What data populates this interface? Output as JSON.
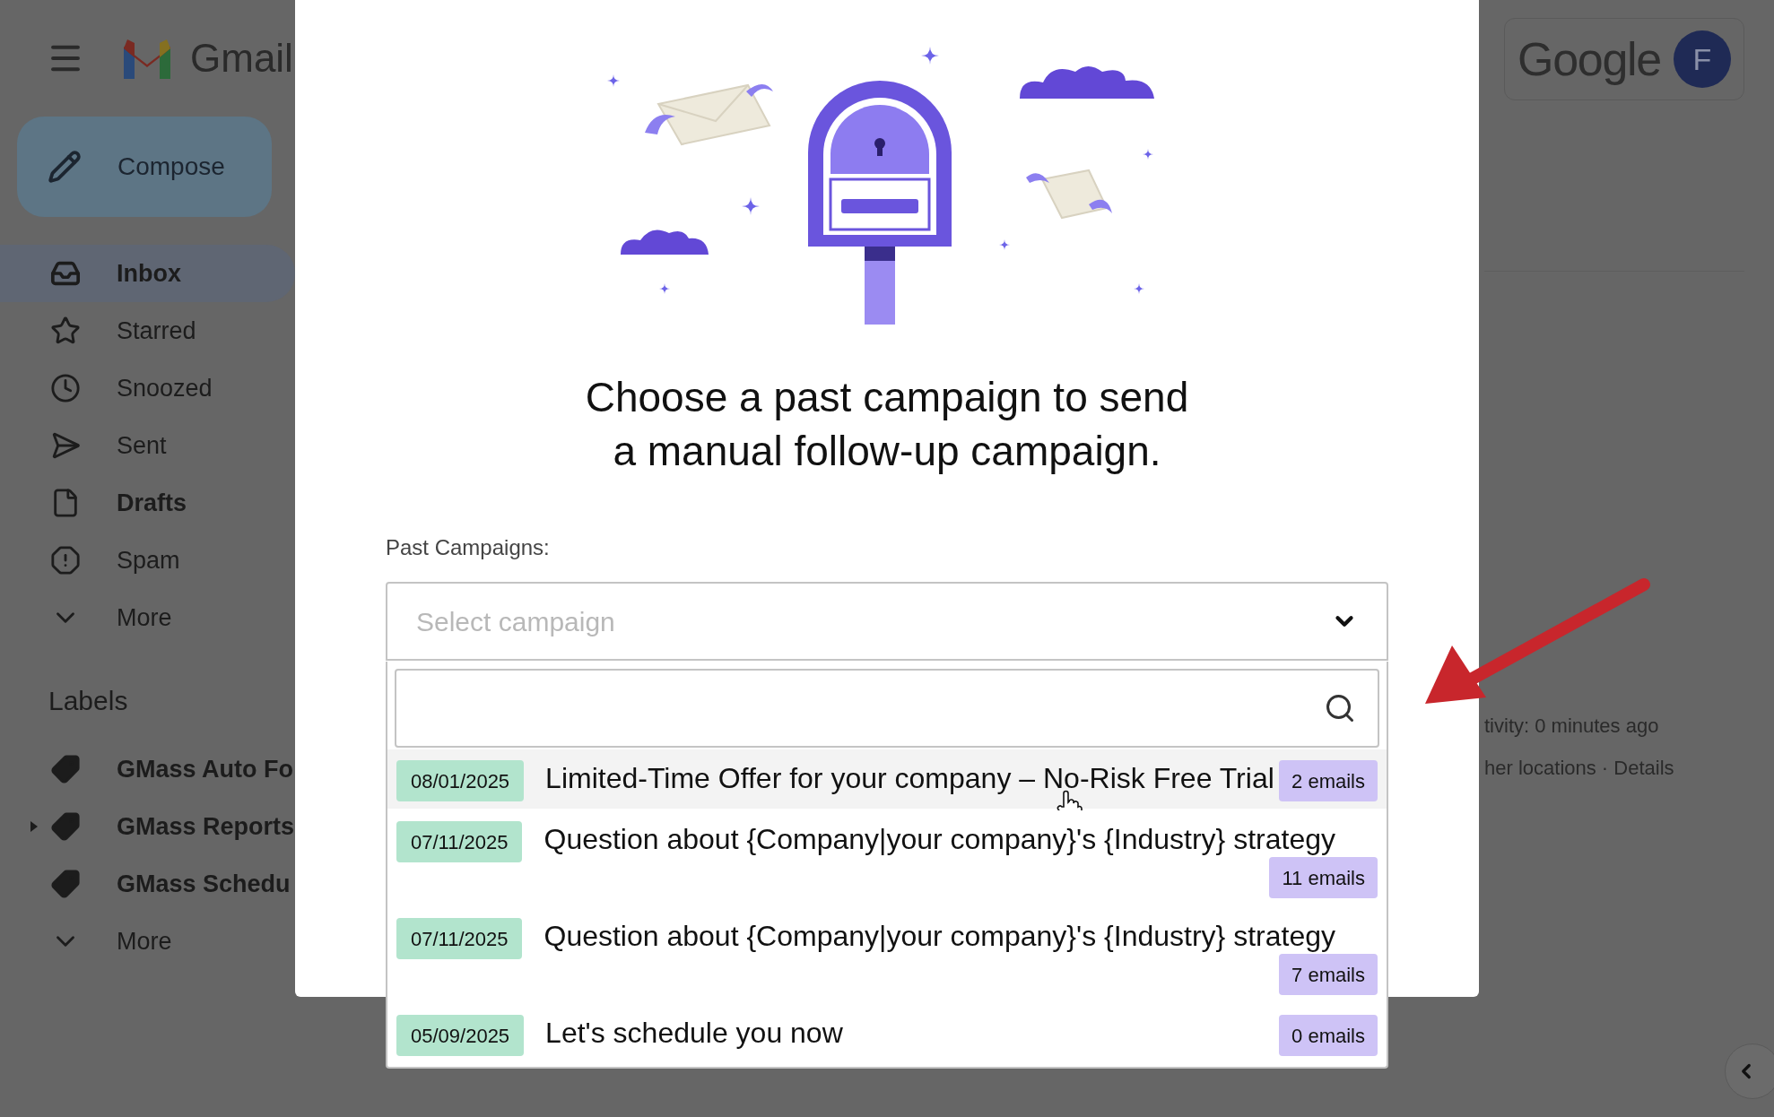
{
  "app": {
    "name": "Gmail"
  },
  "compose": {
    "label": "Compose"
  },
  "nav": [
    {
      "kind": "inbox",
      "label": "Inbox",
      "selected": true,
      "unread": true
    },
    {
      "kind": "star",
      "label": "Starred",
      "selected": false,
      "unread": false
    },
    {
      "kind": "clock",
      "label": "Snoozed",
      "selected": false,
      "unread": false
    },
    {
      "kind": "send",
      "label": "Sent",
      "selected": false,
      "unread": false
    },
    {
      "kind": "file",
      "label": "Drafts",
      "selected": false,
      "unread": true
    },
    {
      "kind": "spam",
      "label": "Spam",
      "selected": false,
      "unread": false
    },
    {
      "kind": "more",
      "label": "More",
      "selected": false,
      "unread": false
    }
  ],
  "labels_heading": "Labels",
  "labels": [
    {
      "label": "GMass Auto Fo",
      "has_children": false
    },
    {
      "label": "GMass Reports",
      "has_children": true
    },
    {
      "label": "GMass Schedu",
      "has_children": false
    }
  ],
  "labels_more": "More",
  "account": {
    "brand": "Google",
    "initial": "F"
  },
  "activity": {
    "line_1": "tivity: 0 minutes ago",
    "line_2": "her locations · Details"
  },
  "modal": {
    "title_lines": [
      "Choose a past campaign to send",
      "a manual follow-up campaign."
    ],
    "field_label": "Past Campaigns:",
    "select_placeholder": "Select campaign",
    "campaigns": [
      {
        "date": "08/01/2025",
        "title": "Limited-Time Offer for your company – No-Risk Free Trial",
        "count": "2 emails",
        "highlighted": true
      },
      {
        "date": "07/11/2025",
        "title": "Question about {Company|your company}'s {Industry} strategy",
        "count": "11 emails",
        "highlighted": false
      },
      {
        "date": "07/11/2025",
        "title": "Question about {Company|your company}'s {Industry} strategy",
        "count": "7 emails",
        "highlighted": false
      },
      {
        "date": "05/09/2025",
        "title": "Let's schedule you now",
        "count": "0 emails",
        "highlighted": false
      }
    ]
  }
}
